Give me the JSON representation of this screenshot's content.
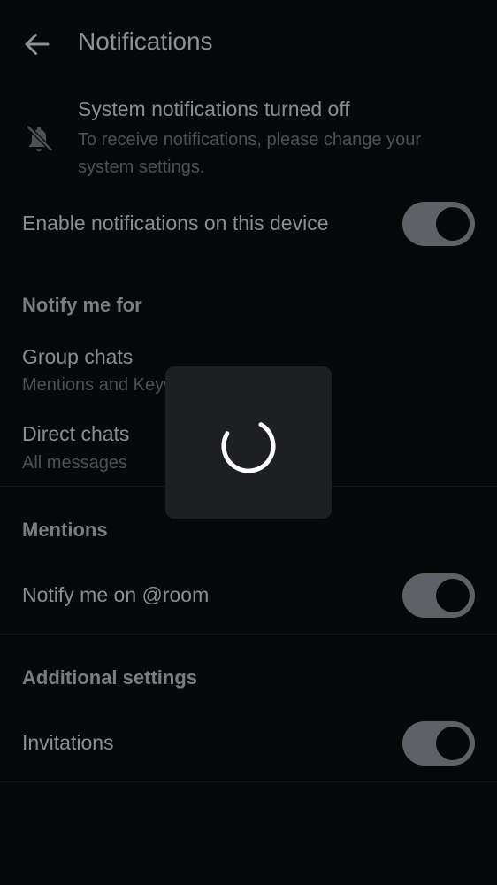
{
  "header": {
    "title": "Notifications",
    "back_icon": "arrow-left-icon"
  },
  "system_notice": {
    "icon": "bell-off-icon",
    "title": "System notifications turned off",
    "subtitle": "To receive notifications, please change your system settings."
  },
  "enable_device": {
    "label": "Enable notifications on this device",
    "checked": true
  },
  "notify_me_for": {
    "header": "Notify me for",
    "items": [
      {
        "label": "Group chats",
        "value": "Mentions and Keywords"
      },
      {
        "label": "Direct chats",
        "value": "All messages"
      }
    ]
  },
  "mentions": {
    "header": "Mentions",
    "room_label": "Notify me on @room",
    "room_checked": true
  },
  "additional": {
    "header": "Additional settings",
    "invitations_label": "Invitations",
    "invitations_checked": true
  },
  "loading": {
    "visible": true,
    "icon": "loading-spinner-icon"
  },
  "colors": {
    "background": "#07080a",
    "overlay": "#1e1f23",
    "toggle_track": "#5f6166",
    "spinner": "#ffffff"
  }
}
